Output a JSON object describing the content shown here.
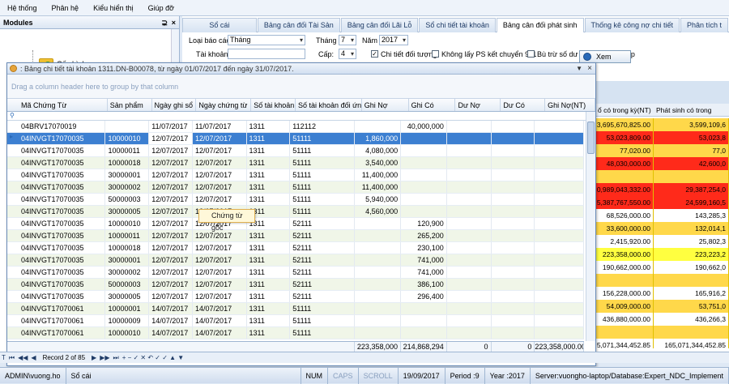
{
  "menu": [
    "Hệ thống",
    "Phân hệ",
    "Kiểu hiển thị",
    "Giúp đỡ"
  ],
  "modules": {
    "title": "Modules",
    "pin": "⊋",
    "close": "×",
    "item": "Cấu hình"
  },
  "tabs": [
    "Sổ cái",
    "Bảng cân đối Tài Sản",
    "Bảng cân đối Lãi Lỗ",
    "Sổ chi tiết tài khoản",
    "Bảng cân đối phát sinh",
    "Thống kê công nợ chi tiết",
    "Phân tích t"
  ],
  "active_tab": 4,
  "filters": {
    "report_type_label": "Loại báo cáo",
    "report_type_value": "Tháng",
    "account_label": "Tài khoản",
    "month_label": "Tháng",
    "month_value": "7",
    "year_label": "Năm",
    "year_value": "2017",
    "level_label": "Cấp:",
    "level_value": "4",
    "chk_detail": "Chi tiết đối tượng",
    "chk_no_ps": "Không lấy PS kết chuyển 911",
    "chk_offset": "Bù trừ số dư trên TK tổng hợp",
    "view_button": "Xem"
  },
  "background_grid": {
    "headers": [
      "ổ có trong kỳ(NT)",
      "Phát sinh có trong kỳ(NT)"
    ],
    "rows": [
      {
        "a": "3,695,670,825.00",
        "b": "3,599,109,6",
        "color": "#ffd84a"
      },
      {
        "a": "53,023,809.00",
        "b": "53,023,8",
        "color": "#ff2a1a"
      },
      {
        "a": "77,020.00",
        "b": "77,0",
        "color": "#ffd84a"
      },
      {
        "a": "48,030,000.00",
        "b": "42,600,0",
        "color": "#ff2a1a"
      },
      {
        "a": "",
        "b": "",
        "color": "#ffd84a"
      },
      {
        "a": "0,989,043,332.00",
        "b": "29,387,254,0",
        "color": "#ff2a1a"
      },
      {
        "a": "5,387,767,550.00",
        "b": "24,599,160,5",
        "color": "#ff2a1a"
      },
      {
        "a": "68,526,000.00",
        "b": "143,285,3",
        "color": "#ffffff"
      },
      {
        "a": "33,600,000.00",
        "b": "132,014,1",
        "color": "#ffd84a"
      },
      {
        "a": "2,415,920.00",
        "b": "25,802,3",
        "color": "#ffffff"
      },
      {
        "a": "223,358,000.00",
        "b": "223,223,2",
        "color": "#ffff40"
      },
      {
        "a": "190,662,000.00",
        "b": "190,662,0",
        "color": "#ffffff"
      },
      {
        "a": "",
        "b": "",
        "color": "#ffd84a"
      },
      {
        "a": "156,228,000.00",
        "b": "165,916,2",
        "color": "#ffffff"
      },
      {
        "a": "54,009,000.00",
        "b": "53,751,0",
        "color": "#ffd84a"
      },
      {
        "a": "436,880,000.00",
        "b": "436,266,3",
        "color": "#ffffff"
      },
      {
        "a": "",
        "b": "",
        "color": "#ffd84a"
      },
      {
        "a": "5,071,344,452.85",
        "b": "165,071,344,452.85",
        "color": "#ffffff"
      }
    ]
  },
  "popup": {
    "title": ": Bảng chi tiết tài khoản 1311.DN-B00078, từ ngày 01/07/2017 đến ngày 31/07/2017.",
    "group_hint": "Drag a column header here to group by that column",
    "columns": [
      "Mã Chứng Từ",
      "Sản phẩm",
      "Ngày ghi sổ",
      "Ngày chứng từ",
      "Số tài khoản",
      "Số tài khoản đối ứng",
      "Ghi Nợ",
      "Ghi Có",
      "Dư Nợ",
      "Dư Có",
      "Ghi Nợ(NT)"
    ],
    "rows": [
      [
        "04BRV17070019",
        "",
        "11/07/2017",
        "11/07/2017",
        "1311",
        "112112",
        "",
        "40,000,000",
        "",
        "",
        ""
      ],
      [
        "04INVGT17070035",
        "10000010",
        "12/07/2017",
        "12/07/2017",
        "1311",
        "51111",
        "1,860,000",
        "",
        "",
        "",
        ""
      ],
      [
        "04INVGT17070035",
        "10000011",
        "12/07/2017",
        "12/07/2017",
        "1311",
        "51111",
        "4,080,000",
        "",
        "",
        "",
        ""
      ],
      [
        "04INVGT17070035",
        "10000018",
        "12/07/2017",
        "12/07/2017",
        "1311",
        "51111",
        "3,540,000",
        "",
        "",
        "",
        ""
      ],
      [
        "04INVGT17070035",
        "30000001",
        "12/07/2017",
        "12/07/2017",
        "1311",
        "51111",
        "11,400,000",
        "",
        "",
        "",
        ""
      ],
      [
        "04INVGT17070035",
        "30000002",
        "12/07/2017",
        "12/07/2017",
        "1311",
        "51111",
        "11,400,000",
        "",
        "",
        "",
        ""
      ],
      [
        "04INVGT17070035",
        "50000003",
        "12/07/2017",
        "12/07/2017",
        "1311",
        "51111",
        "5,940,000",
        "",
        "",
        "",
        ""
      ],
      [
        "04INVGT17070035",
        "30000005",
        "12/07/2017",
        "12/07/2017",
        "1311",
        "51111",
        "4,560,000",
        "",
        "",
        "",
        ""
      ],
      [
        "04INVGT17070035",
        "10000010",
        "12/07/2017",
        "12/07/2017",
        "1311",
        "52111",
        "",
        "120,900",
        "",
        "",
        ""
      ],
      [
        "04INVGT17070035",
        "10000011",
        "12/07/2017",
        "12/07/2017",
        "1311",
        "52111",
        "",
        "265,200",
        "",
        "",
        ""
      ],
      [
        "04INVGT17070035",
        "10000018",
        "12/07/2017",
        "12/07/2017",
        "1311",
        "52111",
        "",
        "230,100",
        "",
        "",
        ""
      ],
      [
        "04INVGT17070035",
        "30000001",
        "12/07/2017",
        "12/07/2017",
        "1311",
        "52111",
        "",
        "741,000",
        "",
        "",
        ""
      ],
      [
        "04INVGT17070035",
        "30000002",
        "12/07/2017",
        "12/07/2017",
        "1311",
        "52111",
        "",
        "741,000",
        "",
        "",
        ""
      ],
      [
        "04INVGT17070035",
        "50000003",
        "12/07/2017",
        "12/07/2017",
        "1311",
        "52111",
        "",
        "386,100",
        "",
        "",
        ""
      ],
      [
        "04INVGT17070035",
        "30000005",
        "12/07/2017",
        "12/07/2017",
        "1311",
        "52111",
        "",
        "296,400",
        "",
        "",
        ""
      ],
      [
        "04INVGT17070061",
        "10000001",
        "14/07/2017",
        "14/07/2017",
        "1311",
        "51111",
        "",
        "",
        "",
        "",
        ""
      ],
      [
        "04INVGT17070061",
        "10000009",
        "14/07/2017",
        "14/07/2017",
        "1311",
        "51111",
        "",
        "",
        "",
        "",
        ""
      ],
      [
        "04INVGT17070061",
        "10000010",
        "14/07/2017",
        "14/07/2017",
        "1311",
        "51111",
        "",
        "",
        "",
        "",
        ""
      ]
    ],
    "totals": [
      "223,358,000",
      "214,868,294",
      "0",
      "0",
      "223,358,000.00"
    ],
    "context_menu": "Chứng từ gốc"
  },
  "navigator": {
    "first": "⏮",
    "prev_page": "◀◀",
    "prev": "◀",
    "record": "Record 2 of 85",
    "next": "▶",
    "next_page": "▶▶",
    "last": "⏭",
    "t_icon": "T",
    "extras": "+ − ✓ ✕ ↶ ✓ ✓ ▲ ▼"
  },
  "status": {
    "user": "ADMIN\\vuong.ho",
    "module": "Sổ cái",
    "num": "NUM",
    "caps": "CAPS",
    "scroll": "SCROLL",
    "date": "19/09/2017",
    "period": "Period :9",
    "year": "Year :2017",
    "server": "Server:vuongho-laptop/Database:Expert_NDC_Implement"
  }
}
